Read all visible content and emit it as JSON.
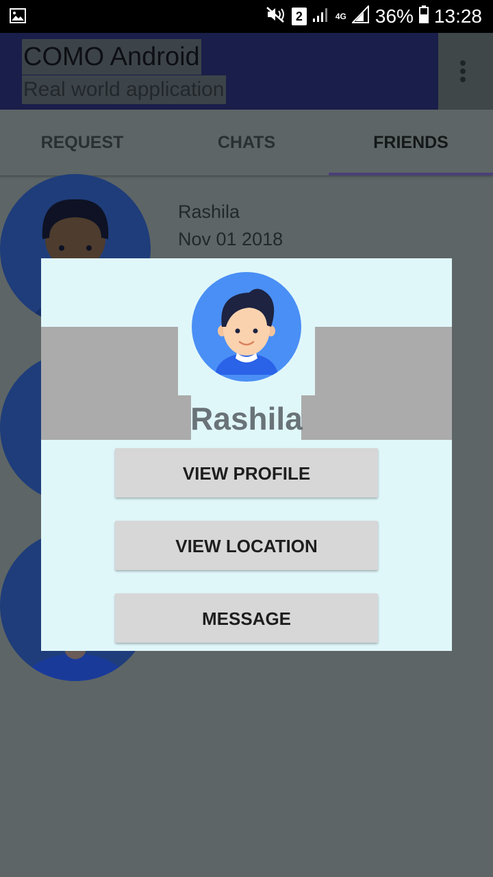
{
  "status_bar": {
    "sim_slot": "2",
    "network": "4G",
    "battery": "36%",
    "time": "13:28"
  },
  "app_bar": {
    "title": "COMO Android",
    "subtitle": "Real world application"
  },
  "tabs": [
    {
      "label": "REQUEST"
    },
    {
      "label": "CHATS"
    },
    {
      "label": "FRIENDS",
      "active": true
    }
  ],
  "friends": [
    {
      "name": "Rashila",
      "date": "Nov 01 2018"
    }
  ],
  "dialog": {
    "name": "Rashila",
    "buttons": [
      {
        "label": "VIEW PROFILE"
      },
      {
        "label": "VIEW LOCATION"
      },
      {
        "label": "MESSAGE"
      }
    ]
  },
  "colors": {
    "app_bar": "#1a237e",
    "tab_indicator": "#7e57c2",
    "dialog_background": "#e0f7fa",
    "avatar_background": "#4a8ff5",
    "button_background": "#d7d7d7"
  }
}
